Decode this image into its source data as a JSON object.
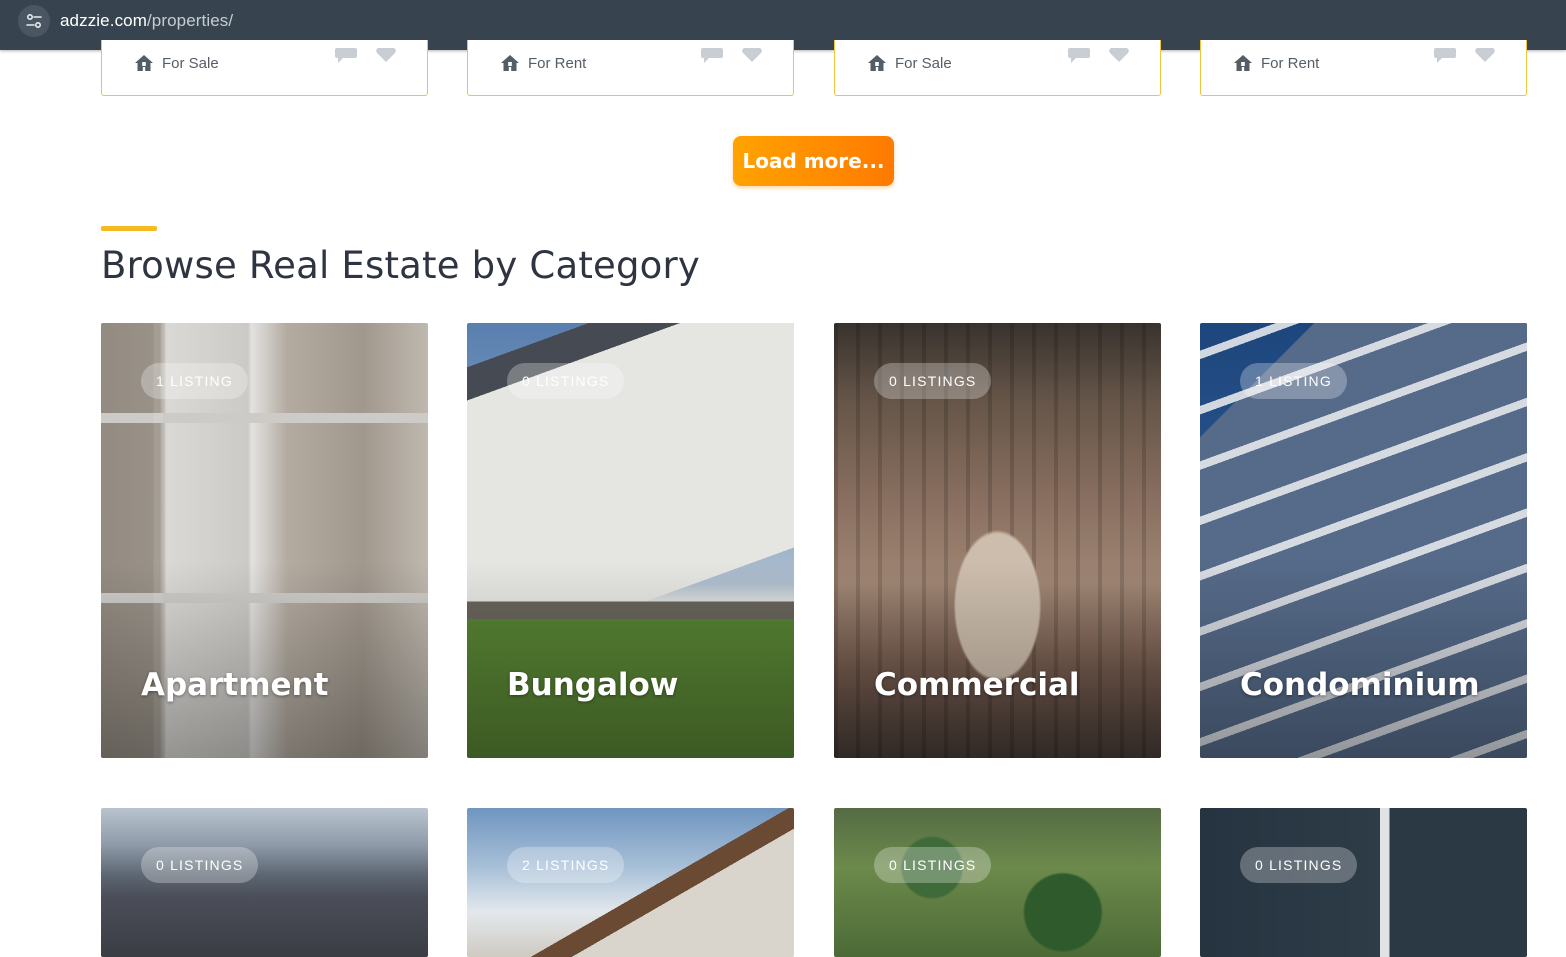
{
  "browser": {
    "url_domain": "adzzie.com",
    "url_path": "/properties/"
  },
  "properties_top": [
    {
      "status": "For Sale"
    },
    {
      "status": "For Rent"
    },
    {
      "status": "For Sale"
    },
    {
      "status": "For Rent"
    }
  ],
  "load_more": {
    "label": "Load more..."
  },
  "section": {
    "title": "Browse Real Estate by Category"
  },
  "categories": [
    {
      "count": "1 LISTING",
      "name": "Apartment"
    },
    {
      "count": "0 LISTINGS",
      "name": "Bungalow"
    },
    {
      "count": "0 LISTINGS",
      "name": "Commercial"
    },
    {
      "count": "1 LISTING",
      "name": "Condominium"
    }
  ],
  "categories_row2": [
    {
      "count": "0 LISTINGS"
    },
    {
      "count": "2 LISTINGS"
    },
    {
      "count": "0 LISTINGS"
    },
    {
      "count": "0 LISTINGS"
    }
  ],
  "colors": {
    "accent": "#f5b922",
    "button_start": "#ffa300",
    "button_end": "#ff7a00",
    "card_border": "#f2c43d",
    "heading": "#2e3440"
  }
}
